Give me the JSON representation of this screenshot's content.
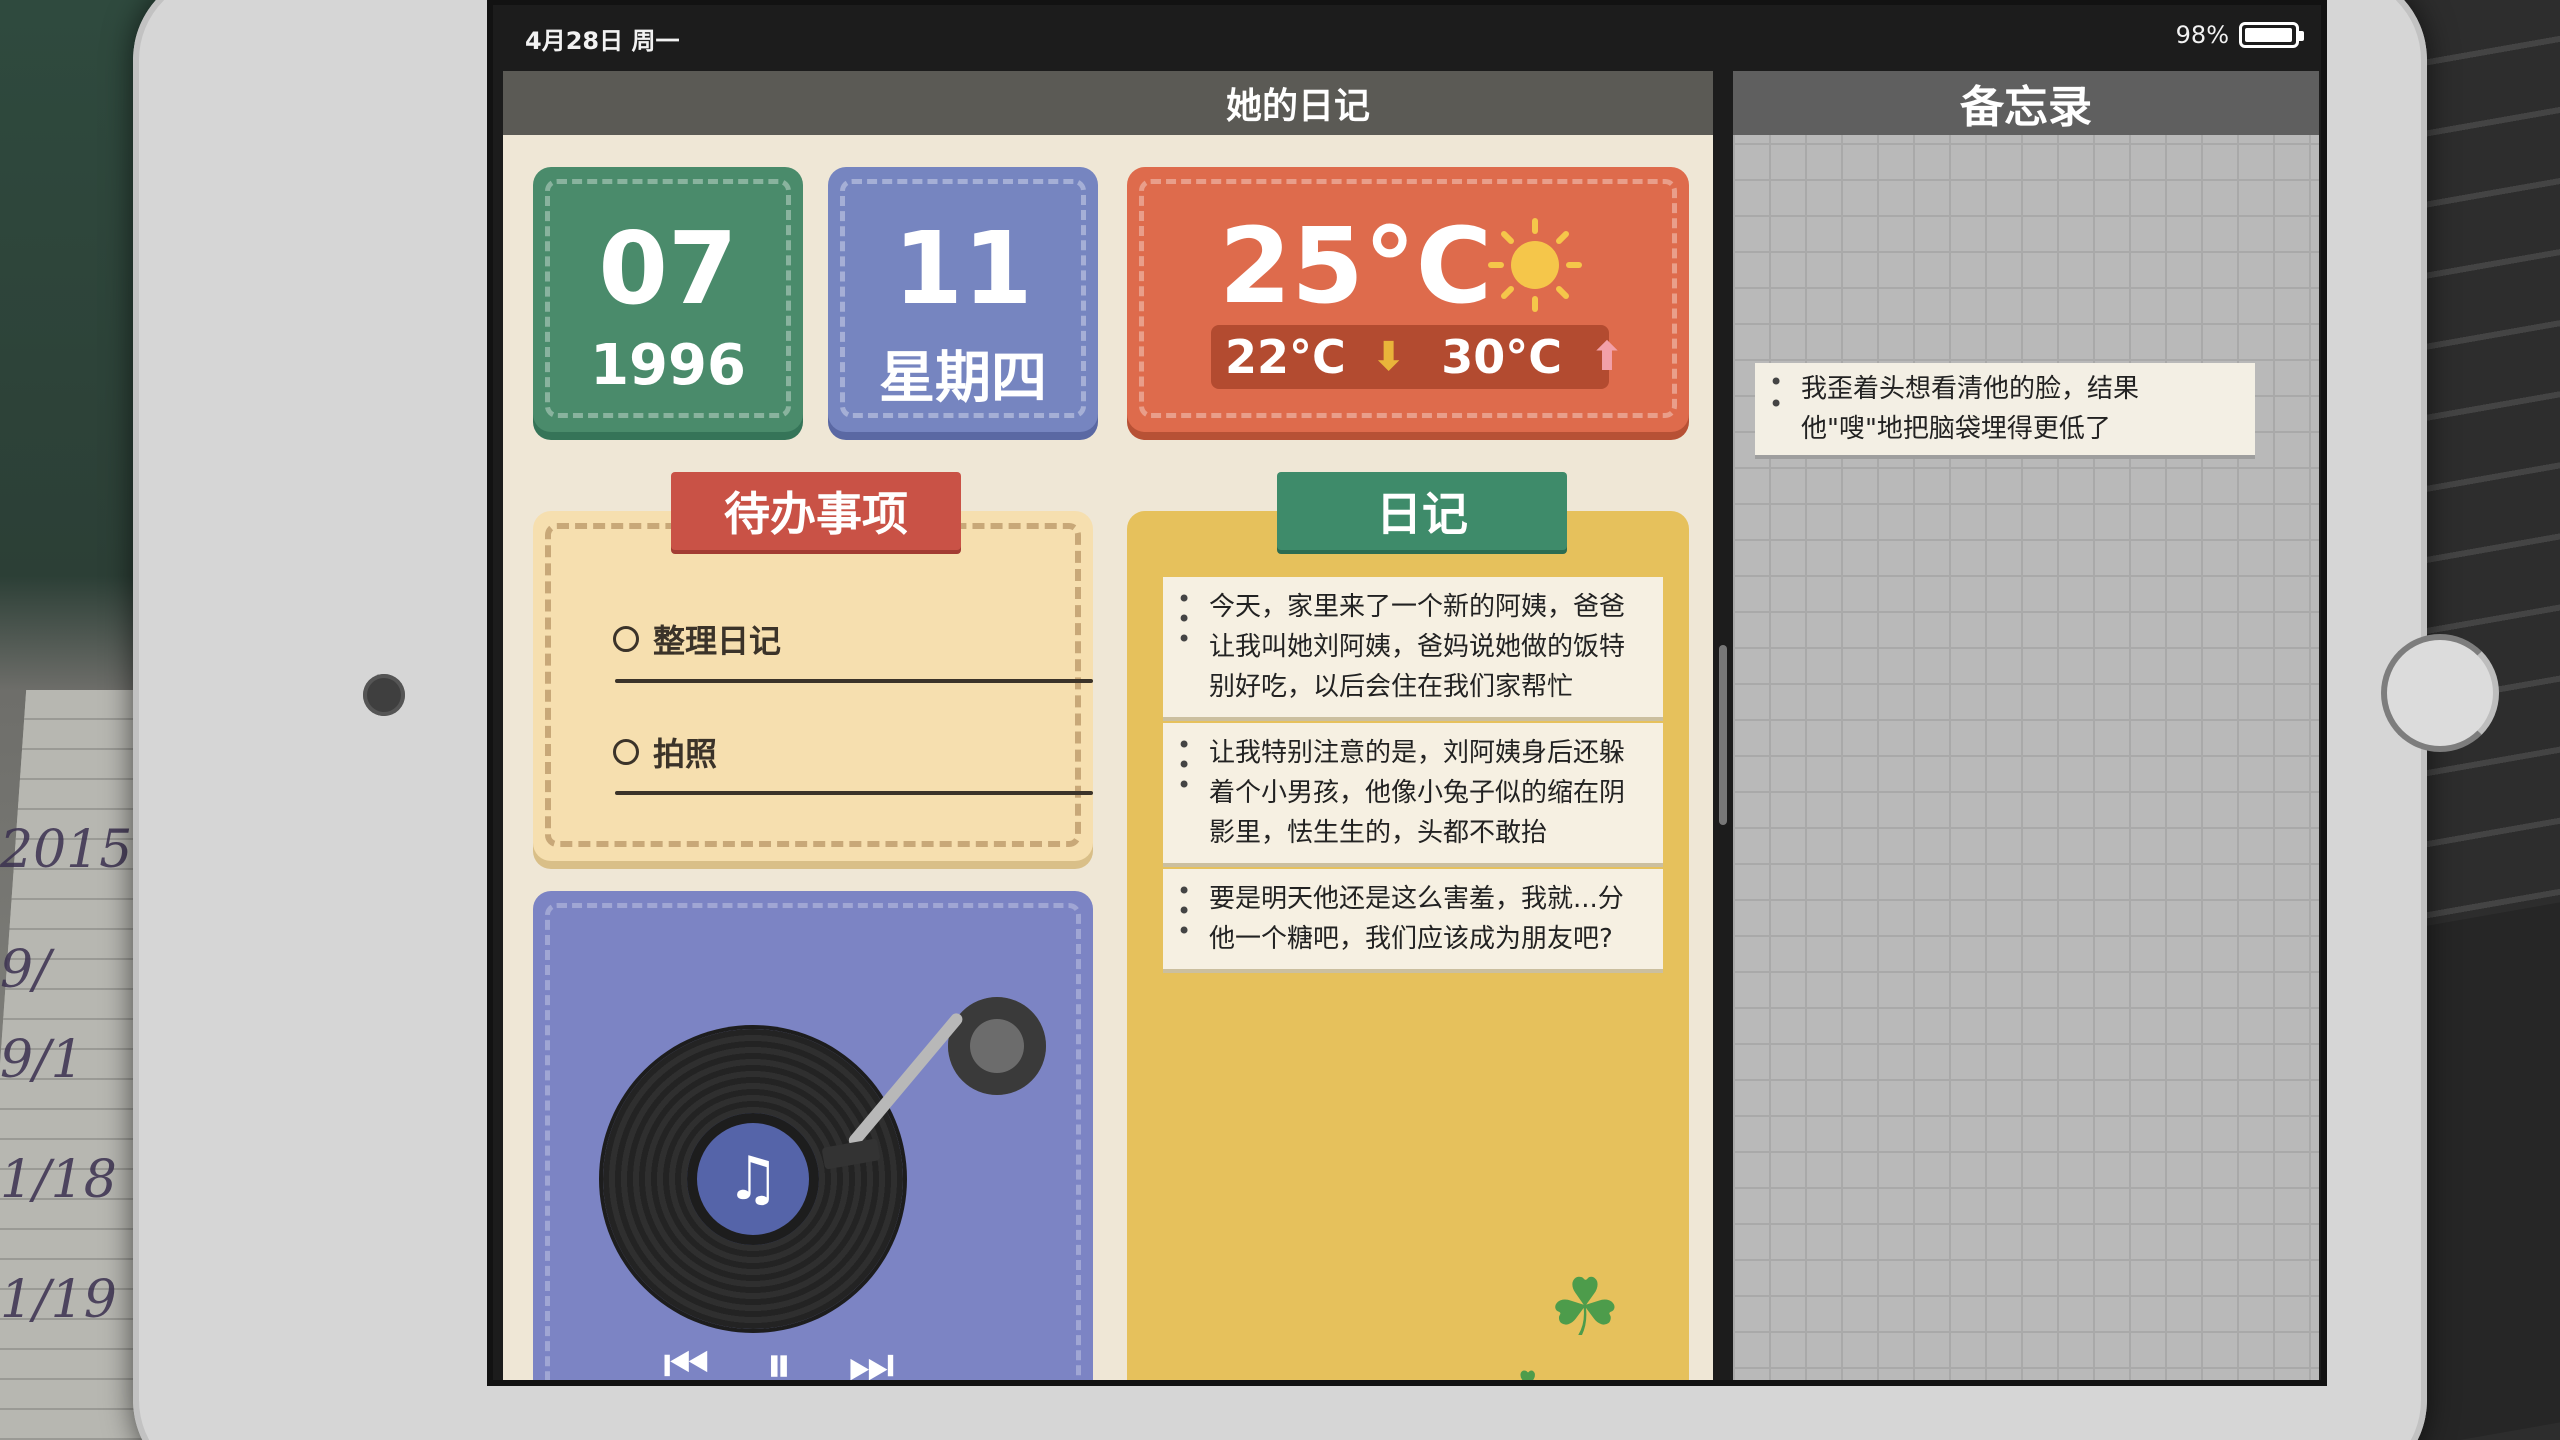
{
  "status_bar": {
    "date": "4月28日 周一",
    "battery": "98%",
    "battery_level": 0.98
  },
  "diary_app": {
    "title": "她的日记",
    "date_cards": [
      {
        "big": "07",
        "small": "1996",
        "color": "#4a8b6b"
      },
      {
        "big": "11",
        "small": "星期四",
        "color": "#7685c0"
      }
    ],
    "weather": {
      "temp": "25°C",
      "low": "22°C",
      "high": "30°C",
      "icon": "sun-icon",
      "color": "#de6b4c"
    },
    "todo": {
      "title": "待办事项",
      "items": [
        "整理日记",
        "拍照"
      ]
    },
    "music_player": {
      "record_icon": "vinyl-record-icon",
      "prev": "⏮",
      "pause": "⏸",
      "next": "⏭"
    },
    "diary": {
      "title": "日记",
      "entries": [
        "今天，家里来了一个新的阿姨，爸爸让我叫她刘阿姨，爸妈说她做的饭特别好吃，以后会住在我们家帮忙",
        "让我特别注意的是，刘阿姨身后还躲着个小男孩，他像小兔子似的缩在阴影里，怯生生的，头都不敢抬",
        "要是明天他还是这么害羞，我就...分他一个糖吧，我们应该成为朋友吧?"
      ]
    }
  },
  "memo_app": {
    "title": "备忘录",
    "notes": [
      "我歪着头想看清他的脸，结果他\"嗖\"地把脑袋埋得更低了"
    ]
  },
  "background": {
    "scribble": [
      "2015",
      "9/",
      "9/1",
      "1/18",
      "1/19"
    ]
  }
}
